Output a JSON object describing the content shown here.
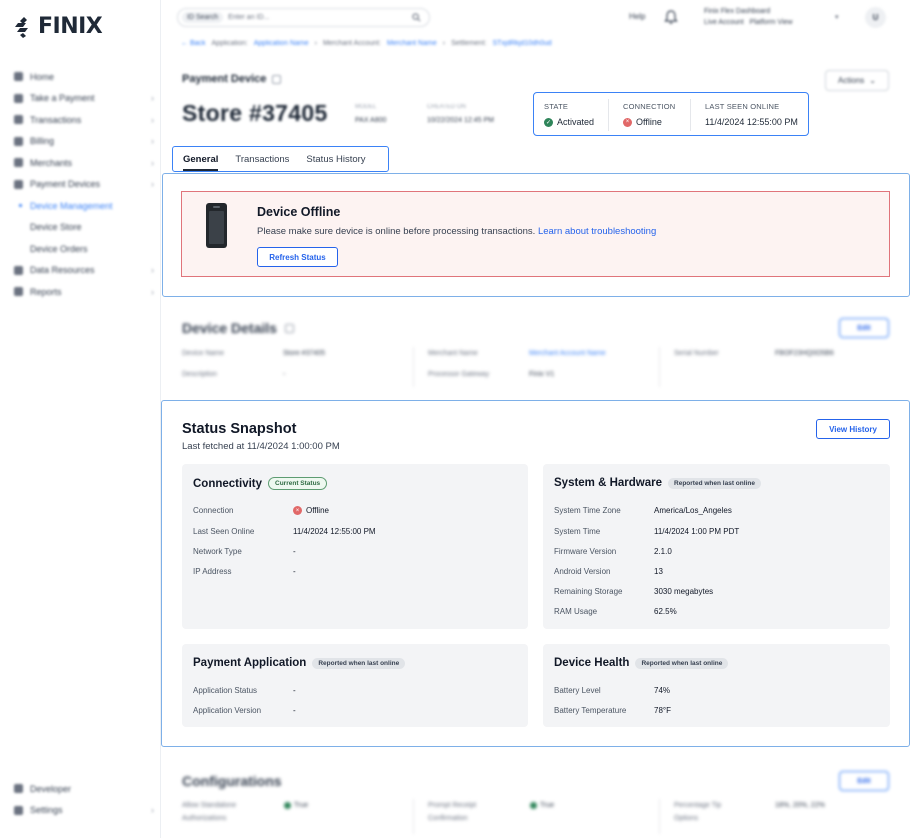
{
  "app": {
    "logo_text": "FINIX"
  },
  "sidebar": {
    "items": [
      {
        "label": "Home",
        "chevron": false
      },
      {
        "label": "Take a Payment",
        "chevron": true
      },
      {
        "label": "Transactions",
        "chevron": true
      },
      {
        "label": "Billing",
        "chevron": true
      },
      {
        "label": "Merchants",
        "chevron": true
      },
      {
        "label": "Payment Devices",
        "chevron": true
      }
    ],
    "sub_items": [
      {
        "label": "Device Management",
        "active": true
      },
      {
        "label": "Device Store",
        "active": false
      },
      {
        "label": "Device Orders",
        "active": false
      }
    ],
    "items_after": [
      {
        "label": "Data Resources",
        "chevron": true
      },
      {
        "label": "Reports",
        "chevron": true
      }
    ],
    "bottom_items": [
      {
        "label": "Developer",
        "chevron": false
      },
      {
        "label": "Settings",
        "chevron": true
      }
    ]
  },
  "topbar": {
    "search_tag": "ID Search",
    "search_placeholder": "Enter an ID...",
    "help_label": "Help",
    "account_name": "Finix Flex Dashboard",
    "account_env": "Live Account",
    "account_view": "Platform View",
    "avatar_initial": "U"
  },
  "breadcrumb": {
    "back": "Back",
    "application_label": "Application:",
    "application_value": "Application Name",
    "merchant_label": "Merchant Account:",
    "merchant_value": "Merchant Name",
    "settlement_label": "Settlement:",
    "settlement_value": "STxjdRkjd10dh0ud"
  },
  "header": {
    "section_label": "Payment Device",
    "store_title": "Store #37405",
    "model_label": "MODEL",
    "model_value": "PAX A800",
    "created_label": "CREATED ON",
    "created_value": "10/22/2024 12:45 PM",
    "actions_label": "Actions"
  },
  "status": {
    "state_label": "STATE",
    "state_value": "Activated",
    "connection_label": "CONNECTION",
    "connection_value": "Offline",
    "last_seen_label": "LAST SEEN ONLINE",
    "last_seen_value": "11/4/2024 12:55:00 PM"
  },
  "tabs": [
    {
      "label": "General",
      "active": true
    },
    {
      "label": "Transactions",
      "active": false
    },
    {
      "label": "Status History",
      "active": false
    }
  ],
  "offline_banner": {
    "title": "Device Offline",
    "message": "Please make sure device is online before processing transactions.",
    "link": "Learn about troubleshooting",
    "button": "Refresh Status"
  },
  "device_details": {
    "title": "Device Details",
    "edit_label": "Edit",
    "device_name_label": "Device Name",
    "device_name_value": "Store #37405",
    "description_label": "Description",
    "description_value": "-",
    "merchant_name_label": "Merchant Name",
    "merchant_name_value": "Merchant Account Name",
    "processor_label": "Processor Gateway",
    "processor_value": "Finix V1",
    "serial_label": "Serial Number",
    "serial_value": "FBOF23HQ0O5B6"
  },
  "snapshot": {
    "title": "Status Snapshot",
    "subtitle": "Last fetched at 11/4/2024 1:00:00 PM",
    "view_history": "View History",
    "connectivity": {
      "title": "Connectivity",
      "badge": "Current Status",
      "rows": [
        {
          "label": "Connection",
          "value": "Offline"
        },
        {
          "label": "Last Seen Online",
          "value": "11/4/2024 12:55:00 PM"
        },
        {
          "label": "Network Type",
          "value": "-"
        },
        {
          "label": "IP Address",
          "value": "-"
        }
      ]
    },
    "system": {
      "title": "System & Hardware",
      "badge": "Reported when last online",
      "rows": [
        {
          "label": "System Time Zone",
          "value": "America/Los_Angeles"
        },
        {
          "label": "System Time",
          "value": "11/4/2024 1:00 PM PDT"
        },
        {
          "label": "Firmware Version",
          "value": "2.1.0"
        },
        {
          "label": "Android Version",
          "value": "13"
        },
        {
          "label": "Remaining Storage",
          "value": "3030 megabytes"
        },
        {
          "label": "RAM Usage",
          "value": "62.5%"
        }
      ]
    },
    "payment_app": {
      "title": "Payment Application",
      "badge": "Reported when last online",
      "rows": [
        {
          "label": "Application Status",
          "value": "-"
        },
        {
          "label": "Application Version",
          "value": "-"
        }
      ]
    },
    "health": {
      "title": "Device Health",
      "badge": "Reported when last online",
      "rows": [
        {
          "label": "Battery Level",
          "value": "74%"
        },
        {
          "label": "Battery Temperature",
          "value": "78°F"
        }
      ]
    }
  },
  "configurations": {
    "title": "Configurations",
    "edit_label": "Edit",
    "allow_standalone_label": "Allow Standalone",
    "allow_standalone_label2": "Authorizations",
    "allow_standalone_value": "True",
    "prompt_receipt_label": "Prompt Receipt",
    "prompt_receipt_label2": "Confirmation",
    "prompt_receipt_value": "True",
    "tip_label": "Percentage Tip",
    "tip_label2": "Options",
    "tip_value": "18%, 20%, 22%"
  },
  "colors": {
    "accent": "#2563eb",
    "offline_red": "#e16868",
    "active_green": "#2f855a",
    "banner_bg": "#fdf3f2"
  }
}
